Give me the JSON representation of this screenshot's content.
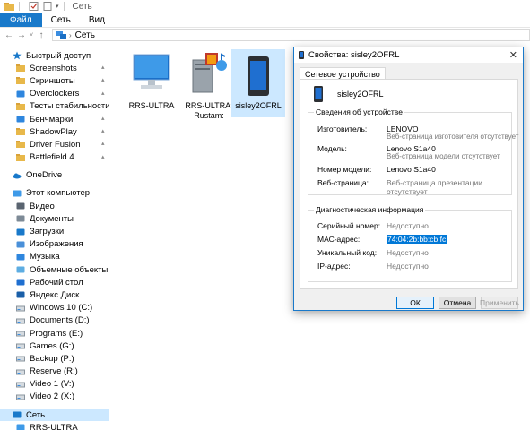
{
  "window": {
    "title": "Сеть"
  },
  "ribbon": {
    "tabs": [
      "Файл",
      "Сеть",
      "Вид"
    ]
  },
  "address": {
    "crumb": "Сеть"
  },
  "sidebar": {
    "items": [
      {
        "label": "Быстрый доступ",
        "icon": "star-icon",
        "level": 0,
        "expander": ""
      },
      {
        "label": "Screenshots",
        "icon": "folder-icon",
        "level": 1,
        "pinned": true
      },
      {
        "label": "Скриншоты",
        "icon": "folder-icon",
        "level": 1,
        "pinned": true
      },
      {
        "label": "Overclockers",
        "icon": "app-icon",
        "level": 1,
        "pinned": true
      },
      {
        "label": "Тесты стабильности",
        "icon": "folder-icon",
        "level": 1,
        "pinned": true
      },
      {
        "label": "Бенчмарки",
        "icon": "app-icon",
        "level": 1,
        "pinned": true
      },
      {
        "label": "ShadowPlay",
        "icon": "folder-icon",
        "level": 1,
        "pinned": true
      },
      {
        "label": "Driver Fusion",
        "icon": "folder-icon",
        "level": 1,
        "pinned": true
      },
      {
        "label": "Battlefield 4",
        "icon": "folder-icon",
        "level": 1,
        "pinned": true
      },
      {
        "label": "",
        "icon": "",
        "level": 0,
        "spacer": true
      },
      {
        "label": "OneDrive",
        "icon": "cloud-icon",
        "level": 0
      },
      {
        "label": "",
        "icon": "",
        "level": 0,
        "spacer": true
      },
      {
        "label": "Этот компьютер",
        "icon": "computer-icon",
        "level": 0
      },
      {
        "label": "Видео",
        "icon": "video-folder-icon",
        "level": 1
      },
      {
        "label": "Документы",
        "icon": "documents-folder-icon",
        "level": 1
      },
      {
        "label": "Загрузки",
        "icon": "downloads-folder-icon",
        "level": 1
      },
      {
        "label": "Изображения",
        "icon": "pictures-folder-icon",
        "level": 1
      },
      {
        "label": "Музыка",
        "icon": "music-folder-icon",
        "level": 1
      },
      {
        "label": "Объемные объекты",
        "icon": "3d-objects-folder-icon",
        "level": 1
      },
      {
        "label": "Рабочий стол",
        "icon": "desktop-folder-icon",
        "level": 1
      },
      {
        "label": "Яндекс.Диск",
        "icon": "yandex-disk-icon",
        "level": 1
      },
      {
        "label": "Windows 10 (C:)",
        "icon": "drive-icon",
        "level": 1
      },
      {
        "label": "Documents (D:)",
        "icon": "drive-icon",
        "level": 1
      },
      {
        "label": "Programs (E:)",
        "icon": "drive-icon",
        "level": 1
      },
      {
        "label": "Games (G:)",
        "icon": "drive-icon",
        "level": 1
      },
      {
        "label": "Backup (P:)",
        "icon": "drive-icon",
        "level": 1
      },
      {
        "label": "Reserve (R:)",
        "icon": "drive-icon",
        "level": 1
      },
      {
        "label": "Video 1 (V:)",
        "icon": "drive-icon",
        "level": 1
      },
      {
        "label": "Video 2 (X:)",
        "icon": "drive-icon",
        "level": 1
      },
      {
        "label": "",
        "icon": "",
        "level": 0,
        "spacer": true
      },
      {
        "label": "Сеть",
        "icon": "network-icon",
        "level": 0,
        "selected": true
      },
      {
        "label": "RRS-ULTRA",
        "icon": "computer-icon",
        "level": 1
      }
    ]
  },
  "devices": [
    {
      "label": "RRS-ULTRA",
      "icon": "monitor-computer-icon"
    },
    {
      "label": "RRS-ULTRA: Rustam:",
      "icon": "media-server-icon"
    },
    {
      "label": "sisley2OFRL",
      "icon": "phone-icon",
      "selected": true
    }
  ],
  "dialog": {
    "title": "Свойства: sisley2OFRL",
    "tab": "Сетевое устройство",
    "device_name": "sisley2OFRL",
    "info_group": "Сведения об устройстве",
    "info": {
      "manufacturer_label": "Изготовитель:",
      "manufacturer_value": "LENOVO",
      "manufacturer_sub": "Веб-страница изготовителя отсутствует",
      "model_label": "Модель:",
      "model_value": "Lenovo S1a40",
      "model_sub": "Веб-страница модели отсутствует",
      "model_number_label": "Номер модели:",
      "model_number_value": "Lenovo S1a40",
      "webpage_label": "Веб-страница:",
      "webpage_value": "Веб-страница презентации отсутствует"
    },
    "diag_group": "Диагностическая информация",
    "diag": {
      "serial_label": "Серийный номер:",
      "serial_value": "Недоступно",
      "mac_label": "МАС-адрес:",
      "mac_value": "74:04:2b:bb:cb:fc",
      "uid_label": "Уникальный код:",
      "uid_value": "Недоступно",
      "ip_label": "IP-адрес:",
      "ip_value": "Недоступно"
    },
    "buttons": {
      "ok": "ОК",
      "cancel": "Отмена",
      "apply": "Применить"
    }
  },
  "colors": {
    "accent": "#1979ca",
    "selection": "#cce8ff",
    "highlight": "#0078d7"
  }
}
